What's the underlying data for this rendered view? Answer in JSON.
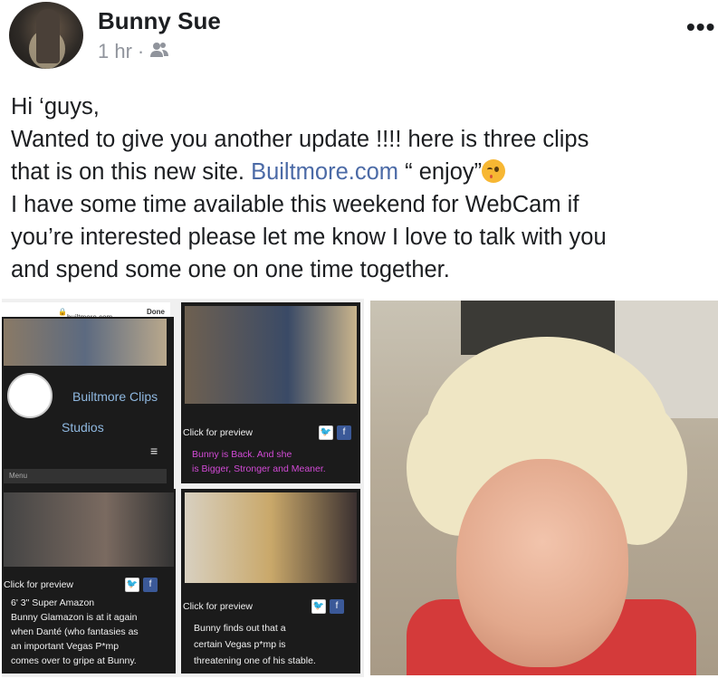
{
  "post": {
    "author": "Bunny Sue",
    "time": "1 hr",
    "separator": "·",
    "audience_icon": "friends-icon",
    "more_label": "•••",
    "text_lines": {
      "l1": "Hi ‘guys,",
      "l2": "Wanted to give you another update !!!! here is three clips",
      "l3a": "that is on this new site. ",
      "l3link": "Builtmore.com",
      "l3b": " “ enjoy”",
      "l4": "I have some time available this weekend for WebCam if",
      "l5": "you’re interested please let me know I love to talk with you",
      "l6": "and spend some one on one time together."
    }
  },
  "collage": {
    "url": "builtmore.com",
    "done": "Done",
    "site_title_1": "Builtmore Clips",
    "site_title_2": "Studios",
    "menu": "Menu",
    "click_preview": "Click for preview",
    "clip1": {
      "line1": "Bunny is Back. And she",
      "line2": "is Bigger, Stronger and Meaner."
    },
    "clip2": {
      "line1": "6' 3\" Super Amazon",
      "line2": "Bunny Glamazon is at it again",
      "line3": "when Danté (who fantasies as",
      "line4": "an important Vegas P*mp",
      "line5": "comes over to gripe at Bunny."
    },
    "clip3": {
      "line1": "Bunny finds out that a",
      "line2": "certain Vegas p*mp is",
      "line3": "threatening one of his stable."
    },
    "fb": "f"
  },
  "colors": {
    "link": "#4b6aa6",
    "meta": "#90949c",
    "accent_preview": "#7fbf3f",
    "magenta": "#d24ad6"
  }
}
